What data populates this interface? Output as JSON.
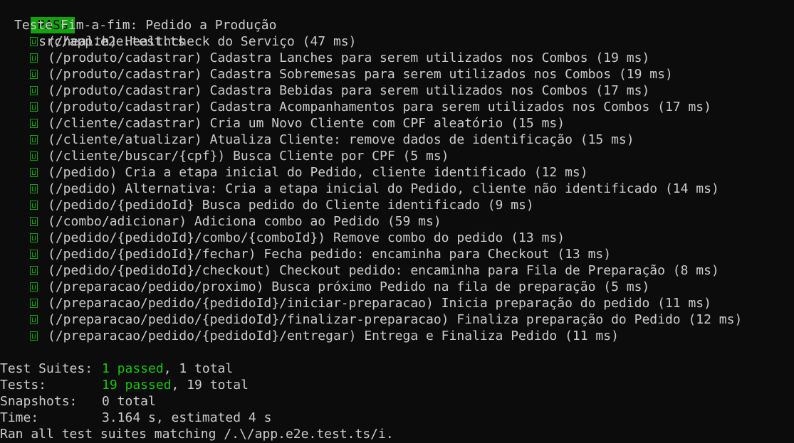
{
  "header": {
    "badge": "PASS",
    "file": "src/app.e2e.test.ts"
  },
  "suite": {
    "title": "Teste Fim-a-fim: Pedido a Produção"
  },
  "tests": [
    {
      "text": "(/health) Healthcheck do Serviço (47 ms)"
    },
    {
      "text": "(/produto/cadastrar) Cadastra Lanches para serem utilizados nos Combos (19 ms)"
    },
    {
      "text": "(/produto/cadastrar) Cadastra Sobremesas para serem utilizados nos Combos (19 ms)"
    },
    {
      "text": "(/produto/cadastrar) Cadastra Bebidas para serem utilizados nos Combos (17 ms)"
    },
    {
      "text": "(/produto/cadastrar) Cadastra Acompanhamentos para serem utilizados nos Combos (17 ms)"
    },
    {
      "text": "(/cliente/cadastrar) Cria um Novo Cliente com CPF aleatório (15 ms)"
    },
    {
      "text": "(/cliente/atualizar) Atualiza Cliente: remove dados de identificação (15 ms)"
    },
    {
      "text": "(/cliente/buscar/{cpf}) Busca Cliente por CPF (5 ms)"
    },
    {
      "text": "(/pedido) Cria a etapa inicial do Pedido, cliente identificado (12 ms)"
    },
    {
      "text": "(/pedido) Alternativa: Cria a etapa inicial do Pedido, cliente não identificado (14 ms)"
    },
    {
      "text": "(/pedido/{pedidoId} Busca pedido do Cliente identificado (9 ms)"
    },
    {
      "text": "(/combo/adicionar) Adiciona combo ao Pedido (59 ms)"
    },
    {
      "text": "(/pedido/{pedidoId}/combo/{comboId}) Remove combo do pedido (13 ms)"
    },
    {
      "text": "(/pedido/{pedidoId}/fechar) Fecha pedido: encaminha para Checkout (13 ms)"
    },
    {
      "text": "(/pedido/{pedidoId}/checkout) Checkout pedido: encaminha para Fila de Preparação (8 ms)"
    },
    {
      "text": "(/preparacao/pedido/proximo) Busca próximo Pedido na fila de preparação (5 ms)"
    },
    {
      "text": "(/preparacao/pedido/{pedidoId}/iniciar-preparacao) Inicia preparação do pedido (11 ms)"
    },
    {
      "text": "(/preparacao/pedido/{pedidoId}/finalizar-preparacao) Finaliza preparação do Pedido (12 ms)"
    },
    {
      "text": "(/preparacao/pedido/{pedidoId}/entregar) Entrega e Finaliza Pedido (11 ms)"
    }
  ],
  "summary": {
    "suites_label": "Test Suites:",
    "suites_passed": "1 passed",
    "suites_rest": ", 1 total",
    "tests_label": "Tests:",
    "tests_passed": "19 passed",
    "tests_rest": ", 19 total",
    "snapshots_label": "Snapshots:",
    "snapshots_value": "0 total",
    "time_label": "Time:",
    "time_value": "3.164 s, estimated 4 s",
    "ran_line": "Ran all test suites matching /.\\/app.e2e.test.ts/i."
  },
  "colors": {
    "background": "#0c0c0c",
    "text": "#cccccc",
    "pass_badge": "#13a10e",
    "passed_text": "#16c60c"
  }
}
